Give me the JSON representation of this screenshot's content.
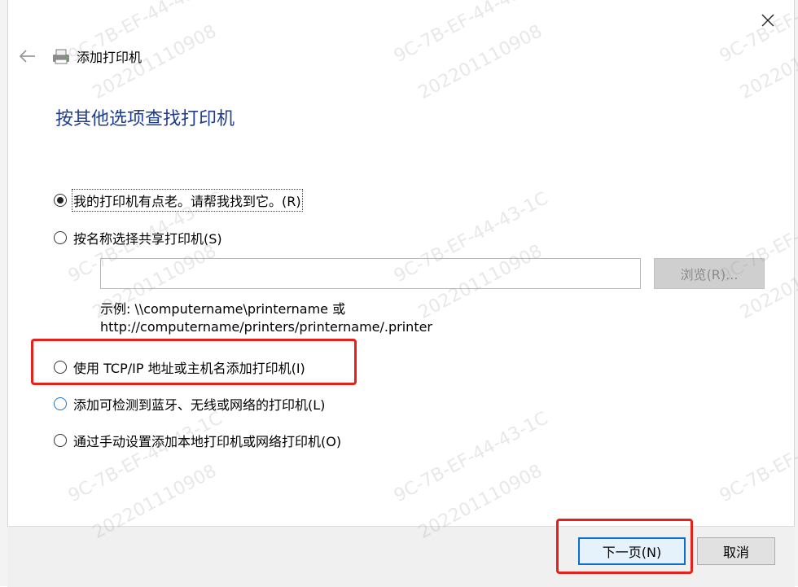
{
  "window": {
    "title": "添加打印机",
    "back_icon": "back-arrow-icon",
    "close_icon": "close-icon",
    "printer_icon": "printer-icon"
  },
  "page": {
    "heading": "按其他选项查找打印机"
  },
  "options": [
    {
      "label": "我的打印机有点老。请帮我找到它。(R)",
      "checked": true
    },
    {
      "label": "按名称选择共享打印机(S)",
      "checked": false
    },
    {
      "label": "使用 TCP/IP 地址或主机名添加打印机(I)",
      "checked": false
    },
    {
      "label": "添加可检测到蓝牙、无线或网络的打印机(L)",
      "checked": false
    },
    {
      "label": "通过手动设置添加本地打印机或网络打印机(O)",
      "checked": false
    }
  ],
  "share": {
    "input_value": "",
    "browse_label": "浏览(R)...",
    "example_line1": "示例: \\\\computername\\printername 或",
    "example_line2": "http://computername/printers/printername/.printer"
  },
  "footer": {
    "next_label": "下一页(N)",
    "cancel_label": "取消"
  },
  "watermark": {
    "lines": [
      "9C-7B-EF-44-43-1C",
      "202201110908"
    ]
  },
  "colors": {
    "heading": "#1e3d8f",
    "highlight": "#e8201a",
    "primary_border": "#0c6fd0"
  }
}
